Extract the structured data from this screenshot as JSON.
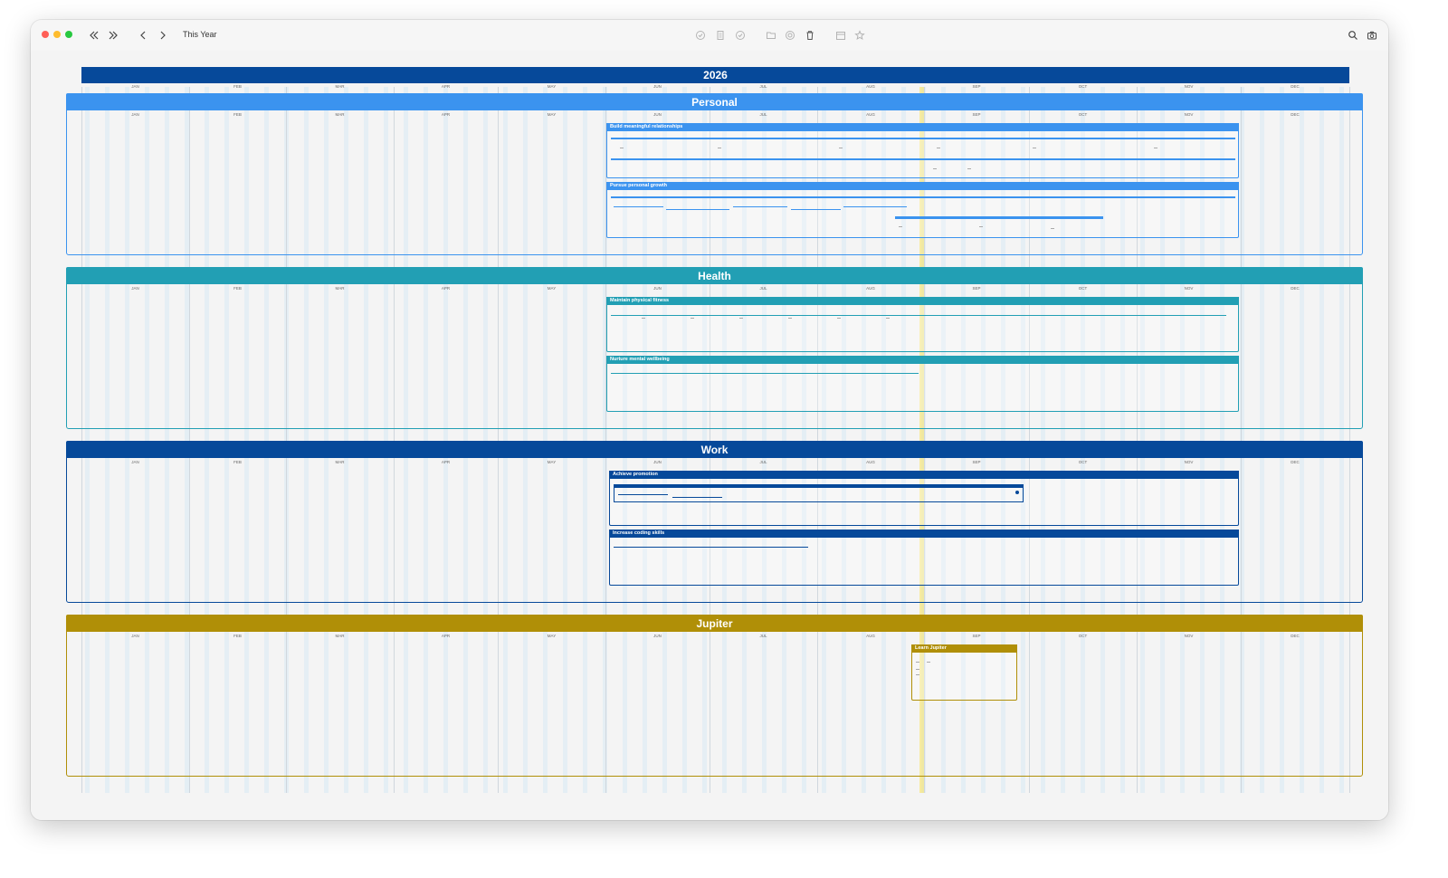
{
  "window": {
    "title": "This Year"
  },
  "toolbar": {
    "icons": [
      "back-double-chevron-icon",
      "forward-double-chevron-icon",
      "chevron-left-icon",
      "chevron-right-icon",
      "check-circle-icon",
      "document-icon",
      "check-circle-icon",
      "folder-icon",
      "target-icon",
      "trash-icon",
      "calendar-icon",
      "star-icon",
      "search-icon",
      "camera-icon"
    ]
  },
  "timeline": {
    "year": "2026",
    "months": [
      "JAN",
      "FEB",
      "MAR",
      "APR",
      "MAY",
      "JUN",
      "JUL",
      "AUG",
      "SEP",
      "OCT",
      "NOV",
      "DEC"
    ]
  },
  "colors": {
    "personal": "#3b93ef",
    "health": "#229fb4",
    "work": "#06499a",
    "jupiter": "#b08f07",
    "today": "#f5dc5a"
  },
  "groups": [
    {
      "label": "Personal",
      "goals": [
        {
          "label": "Build meaningful relationships"
        },
        {
          "label": "Pursue personal growth"
        }
      ]
    },
    {
      "label": "Health",
      "goals": [
        {
          "label": "Maintain physical fitness"
        },
        {
          "label": "Nurture mental wellbeing"
        }
      ]
    },
    {
      "label": "Work",
      "goals": [
        {
          "label": "Achieve promotion"
        },
        {
          "label": "Increase coding skills"
        }
      ]
    },
    {
      "label": "Jupiter",
      "goals": [
        {
          "label": "Learn Jupiter"
        }
      ]
    }
  ]
}
